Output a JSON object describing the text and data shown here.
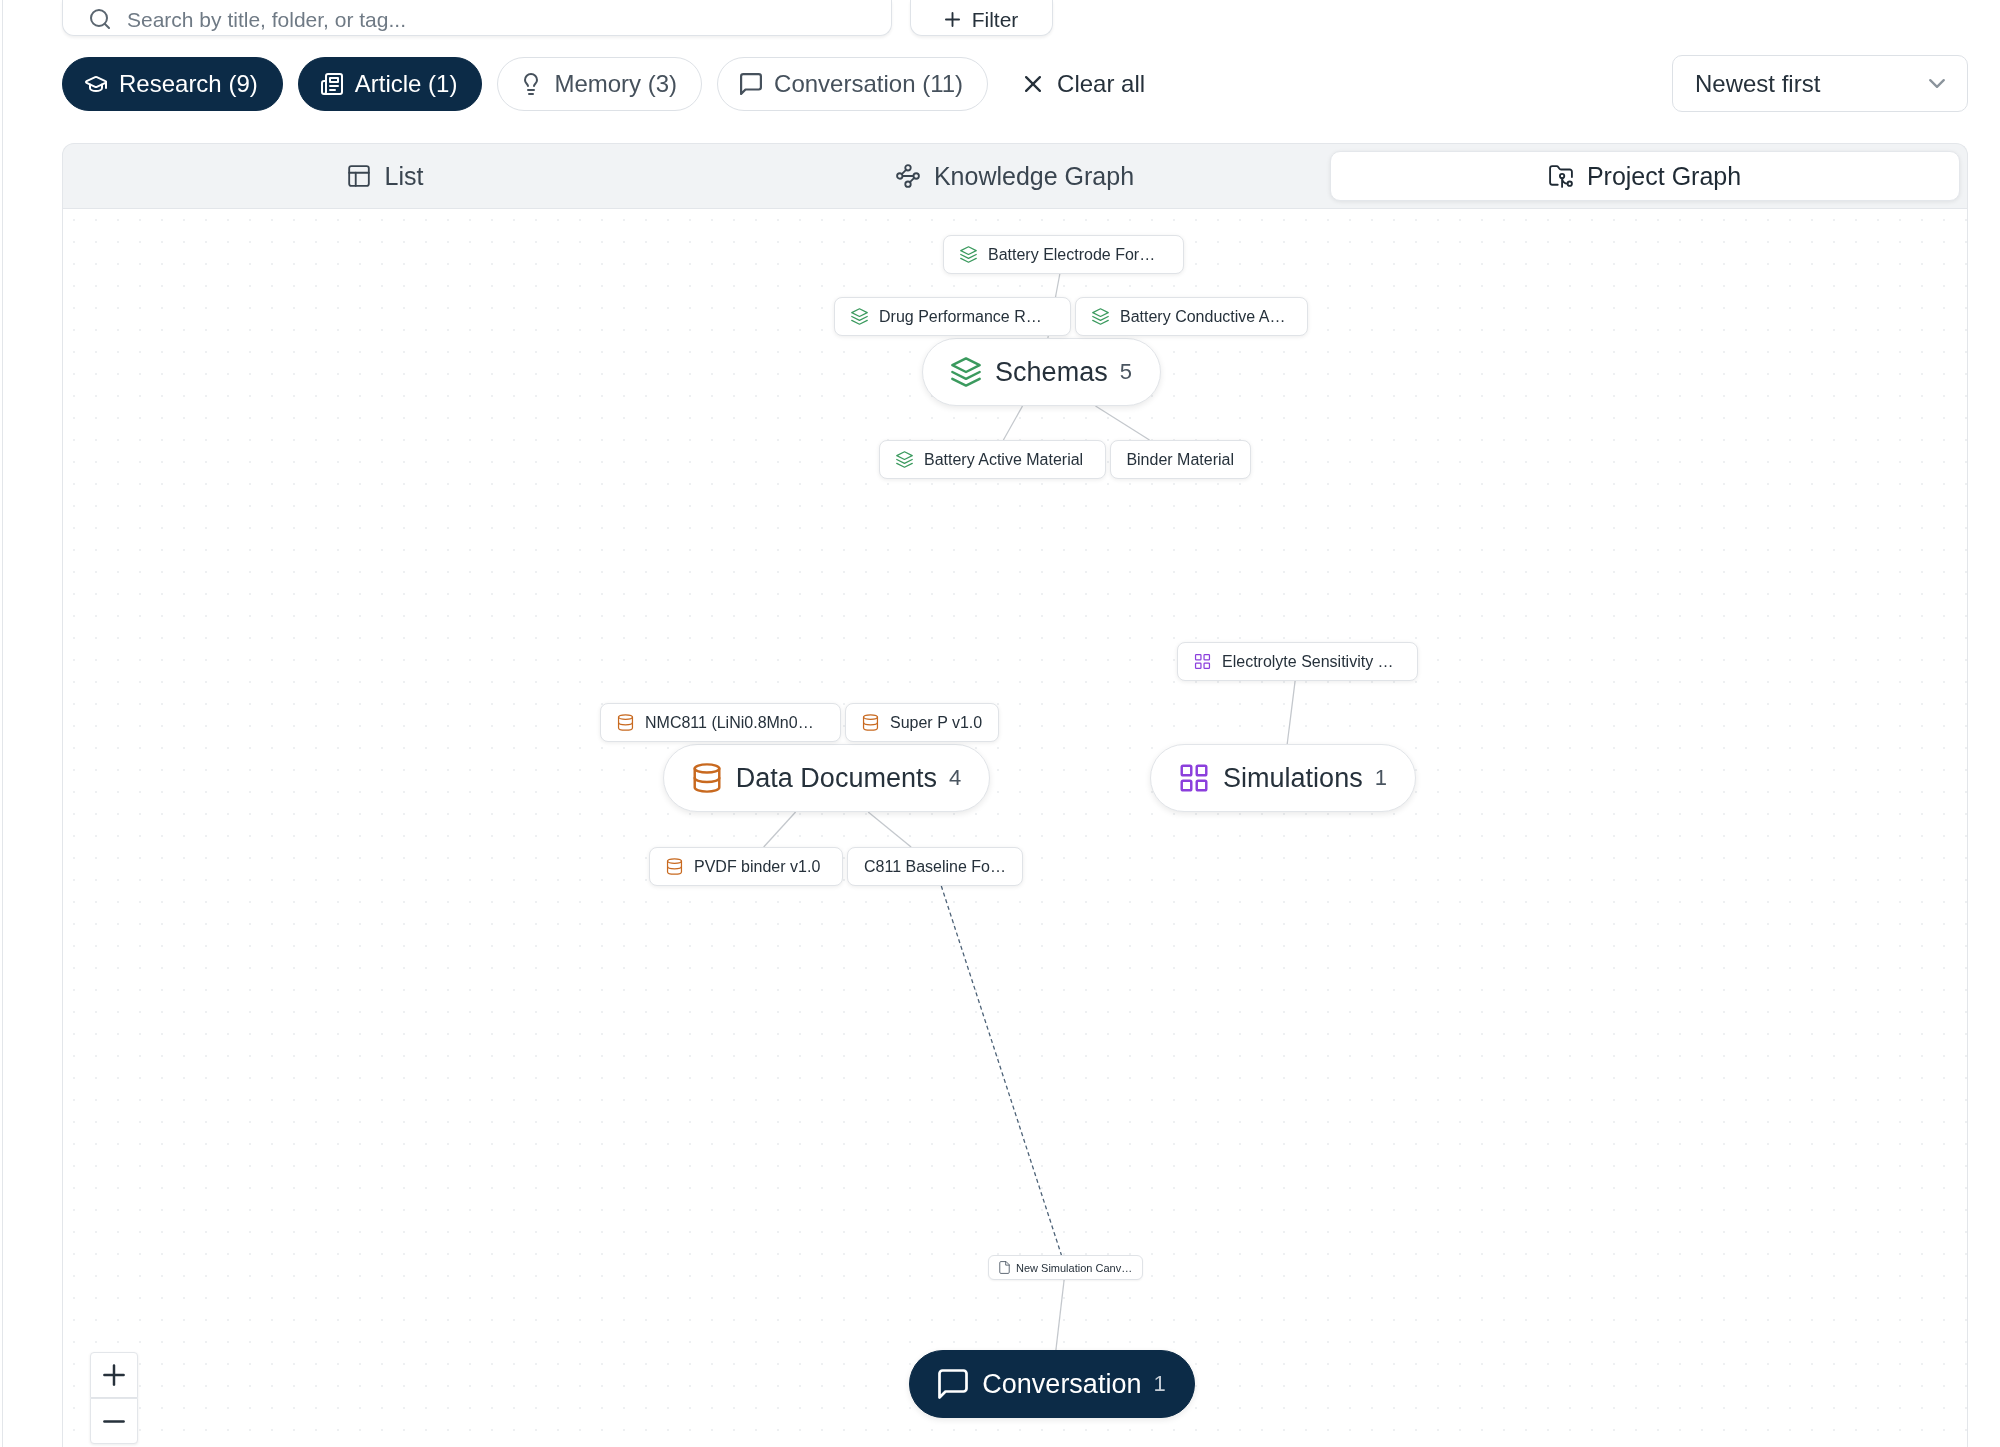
{
  "search": {
    "placeholder": "Search by title, folder, or tag..."
  },
  "filter_button": {
    "label": "Filter"
  },
  "filter_chips": [
    {
      "kind": "research",
      "label": "Research (9)",
      "selected": true
    },
    {
      "kind": "article",
      "label": "Article (1)",
      "selected": true
    },
    {
      "kind": "memory",
      "label": "Memory (3)",
      "selected": false
    },
    {
      "kind": "conversation",
      "label": "Conversation (11)",
      "selected": false
    }
  ],
  "clear_all": {
    "label": "Clear all"
  },
  "sort": {
    "value": "Newest first"
  },
  "view_tabs": [
    {
      "kind": "list",
      "label": "List",
      "selected": false
    },
    {
      "kind": "knowledge",
      "label": "Knowledge Graph",
      "selected": false
    },
    {
      "kind": "project",
      "label": "Project Graph",
      "selected": true
    }
  ],
  "graph": {
    "clusters": [
      {
        "kind": "schema",
        "label": "Schemas",
        "count": "5",
        "color": "#3b9a5e",
        "selected": false,
        "children": [
          {
            "label": "Battery Electrode For…",
            "show_icon": true
          },
          {
            "label": "Drug Performance R…",
            "show_icon": true
          },
          {
            "label": "Battery Conductive A…",
            "show_icon": true
          },
          {
            "label": "Battery Active Material",
            "show_icon": true
          },
          {
            "label": "Binder Material",
            "show_icon": false
          }
        ]
      },
      {
        "kind": "data",
        "label": "Data Documents",
        "count": "4",
        "color": "#c8691f",
        "selected": false,
        "children": [
          {
            "label": "NMC811 (LiNi0.8Mn0…",
            "show_icon": true
          },
          {
            "label": "Super P v1.0",
            "show_icon": true
          },
          {
            "label": "PVDF binder v1.0",
            "show_icon": true
          },
          {
            "label": "C811 Baseline Fo…",
            "show_icon": false
          }
        ]
      },
      {
        "kind": "simulation",
        "label": "Simulations",
        "count": "1",
        "color": "#8b3fdc",
        "selected": false,
        "children": [
          {
            "label": "Electrolyte Sensitivity …",
            "show_icon": true
          }
        ]
      },
      {
        "kind": "conversation",
        "label": "Conversation",
        "count": "1",
        "color": "#0c2b47",
        "selected": true,
        "children": [
          {
            "label": "New Simulation Canv…",
            "show_icon": true
          }
        ]
      }
    ]
  }
}
